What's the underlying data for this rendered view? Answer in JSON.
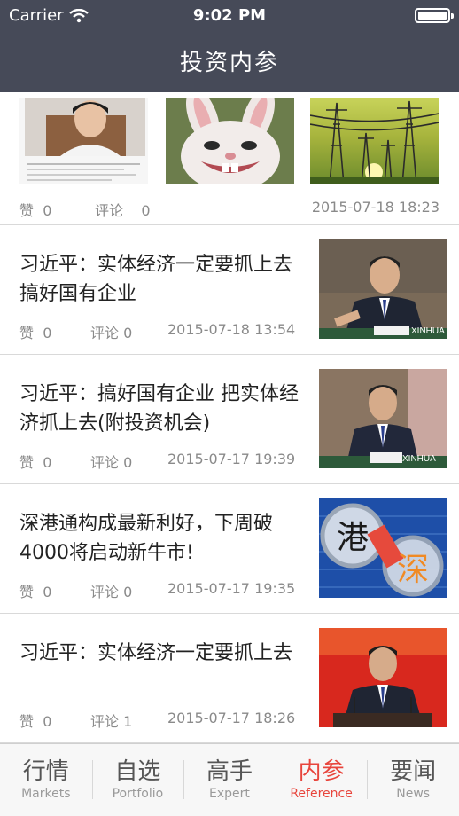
{
  "status_bar": {
    "carrier": "Carrier",
    "time": "9:02 PM"
  },
  "header": {
    "title": "投资内参"
  },
  "gallery": {
    "likes_label": "赞",
    "likes": "0",
    "comments_label": "评论",
    "comments": "0",
    "date": "2015-07-18 18:23"
  },
  "news": [
    {
      "title": "习近平：实体经济一定要抓上去 搞好国有企业",
      "likes_label": "赞",
      "likes": "0",
      "comments_label": "评论",
      "comments": "0",
      "date": "2015-07-18 13:54"
    },
    {
      "title": "习近平：搞好国有企业 把实体经济抓上去(附投资机会)",
      "likes_label": "赞",
      "likes": "0",
      "comments_label": "评论",
      "comments": "0",
      "date": "2015-07-17 19:39"
    },
    {
      "title": "深港通构成最新利好，下周破4000将启动新牛市!",
      "likes_label": "赞",
      "likes": "0",
      "comments_label": "评论",
      "comments": "0",
      "date": "2015-07-17 19:35"
    },
    {
      "title": "习近平：实体经济一定要抓上去",
      "likes_label": "赞",
      "likes": "0",
      "comments_label": "评论",
      "comments": "1",
      "date": "2015-07-17 18:26"
    }
  ],
  "image_text": {
    "xinhua_1": "XINHUA",
    "xinhua_2": "XINHUA",
    "gang": "港",
    "shen": "深"
  },
  "tabs": [
    {
      "cn": "行情",
      "en": "Markets"
    },
    {
      "cn": "自选",
      "en": "Portfolio"
    },
    {
      "cn": "高手",
      "en": "Expert"
    },
    {
      "cn": "内参",
      "en": "Reference"
    },
    {
      "cn": "要闻",
      "en": "News"
    }
  ],
  "colors": {
    "nav": "#464a58",
    "active_tab": "#e8453c",
    "meta_text": "#8a8a8a"
  }
}
